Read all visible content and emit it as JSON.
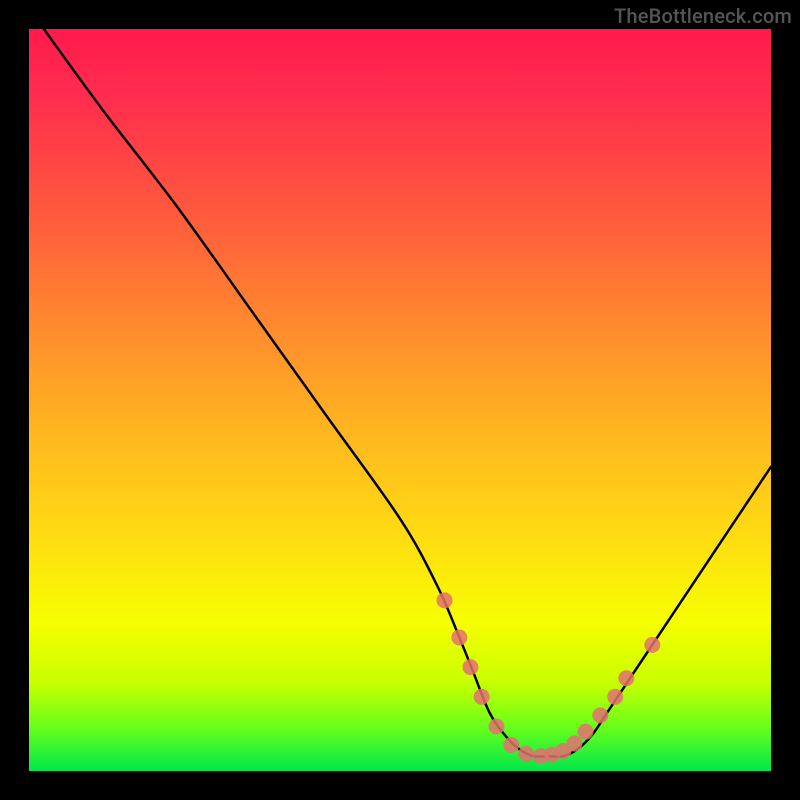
{
  "attribution": "TheBottleneck.com",
  "chart_data": {
    "type": "line",
    "title": "",
    "xlabel": "",
    "ylabel": "",
    "xlim": [
      0,
      100
    ],
    "ylim": [
      0,
      100
    ],
    "grid": false,
    "legend": false,
    "series": [
      {
        "name": "curve",
        "x": [
          2,
          10,
          20,
          30,
          40,
          50,
          55,
          58,
          60,
          62,
          64,
          66,
          68,
          70,
          72,
          74,
          76,
          78,
          82,
          88,
          94,
          100
        ],
        "y": [
          100,
          89,
          76,
          62,
          48,
          34,
          25,
          18,
          13,
          8,
          5,
          3,
          2,
          2,
          2,
          3,
          5,
          8,
          14,
          23,
          32,
          41
        ],
        "color": "#000000"
      }
    ],
    "markers": [
      {
        "name": "highlight-points",
        "color": "#e3716f",
        "radius": 8,
        "points": [
          {
            "x": 56,
            "y": 23
          },
          {
            "x": 58,
            "y": 18
          },
          {
            "x": 59.5,
            "y": 14
          },
          {
            "x": 61,
            "y": 10
          },
          {
            "x": 63,
            "y": 6
          },
          {
            "x": 65,
            "y": 3.5
          },
          {
            "x": 67,
            "y": 2.3
          },
          {
            "x": 69,
            "y": 2
          },
          {
            "x": 70.5,
            "y": 2.2
          },
          {
            "x": 72,
            "y": 2.7
          },
          {
            "x": 73.5,
            "y": 3.7
          },
          {
            "x": 75,
            "y": 5.3
          },
          {
            "x": 77,
            "y": 7.5
          },
          {
            "x": 79,
            "y": 10
          },
          {
            "x": 80.5,
            "y": 12.5
          },
          {
            "x": 84,
            "y": 17
          }
        ]
      }
    ]
  }
}
